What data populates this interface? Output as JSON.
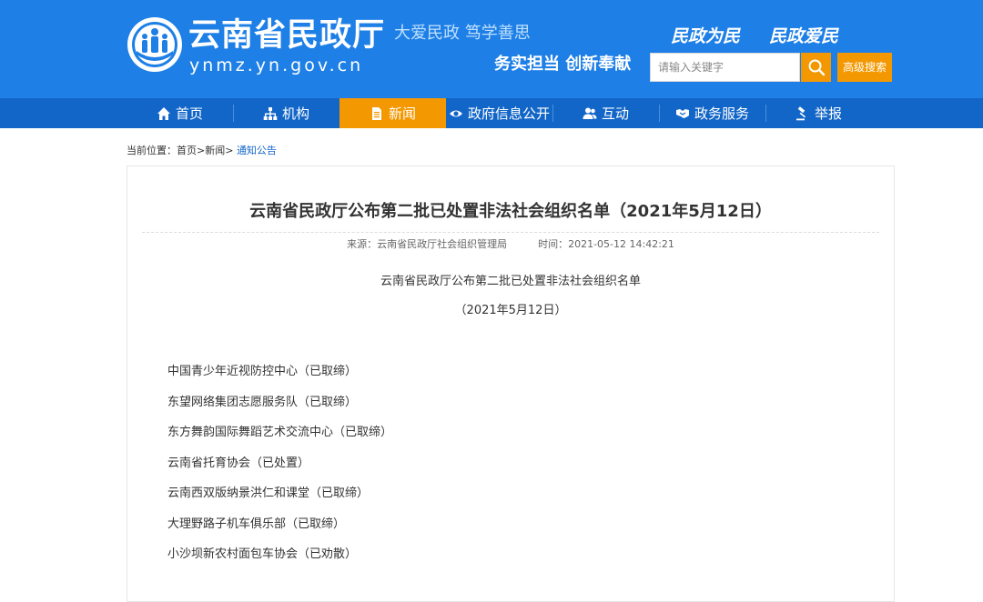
{
  "header": {
    "site_title": "云南省民政厅",
    "site_domain": "ynmz.yn.gov.cn",
    "slogan_1": "大爱民政 笃学善思",
    "slogan_2": "务实担当 创新奉献",
    "motto_1": "民政为民",
    "motto_2": "民政爱民",
    "search_placeholder": "请输入关键字",
    "advanced_search_label": "高级搜索",
    "logo_icon": "people-emblem-icon",
    "search_icon": "search-icon"
  },
  "nav": {
    "items": [
      {
        "label": "首页",
        "icon": "home-icon"
      },
      {
        "label": "机构",
        "icon": "org-chart-icon"
      },
      {
        "label": "新闻",
        "icon": "document-icon"
      },
      {
        "label": "政府信息公开",
        "icon": "eye-icon"
      },
      {
        "label": "互动",
        "icon": "users-icon"
      },
      {
        "label": "政务服务",
        "icon": "handshake-icon"
      },
      {
        "label": "举报",
        "icon": "gavel-icon"
      }
    ],
    "active_index": 2
  },
  "breadcrumb": {
    "prefix": "当前位置：",
    "home": "首页",
    "sep": ">",
    "news": "新闻",
    "current": "通知公告"
  },
  "article": {
    "title": "云南省民政厅公布第二批已处置非法社会组织名单（2021年5月12日）",
    "source_label": "来源：",
    "source": "云南省民政厅社会组织管理局",
    "time_label": "时间：",
    "time": "2021-05-12 14:42:21",
    "body_heading": "云南省民政厅公布第二批已处置非法社会组织名单",
    "body_date": "（2021年5月12日）",
    "items": [
      "中国青少年近视防控中心（已取缔）",
      "东望网络集团志愿服务队（已取缔）",
      "东方舞韵国际舞蹈艺术交流中心（已取缔）",
      "云南省托育协会（已处置）",
      "云南西双版纳景洪仁和课堂（已取缔）",
      "大理野路子机车俱乐部（已取缔）",
      "小沙坝新农村面包车协会（已劝散）"
    ]
  },
  "colors": {
    "header_blue": "#1e7fe6",
    "nav_blue": "#1266c8",
    "accent_orange": "#f39800"
  }
}
